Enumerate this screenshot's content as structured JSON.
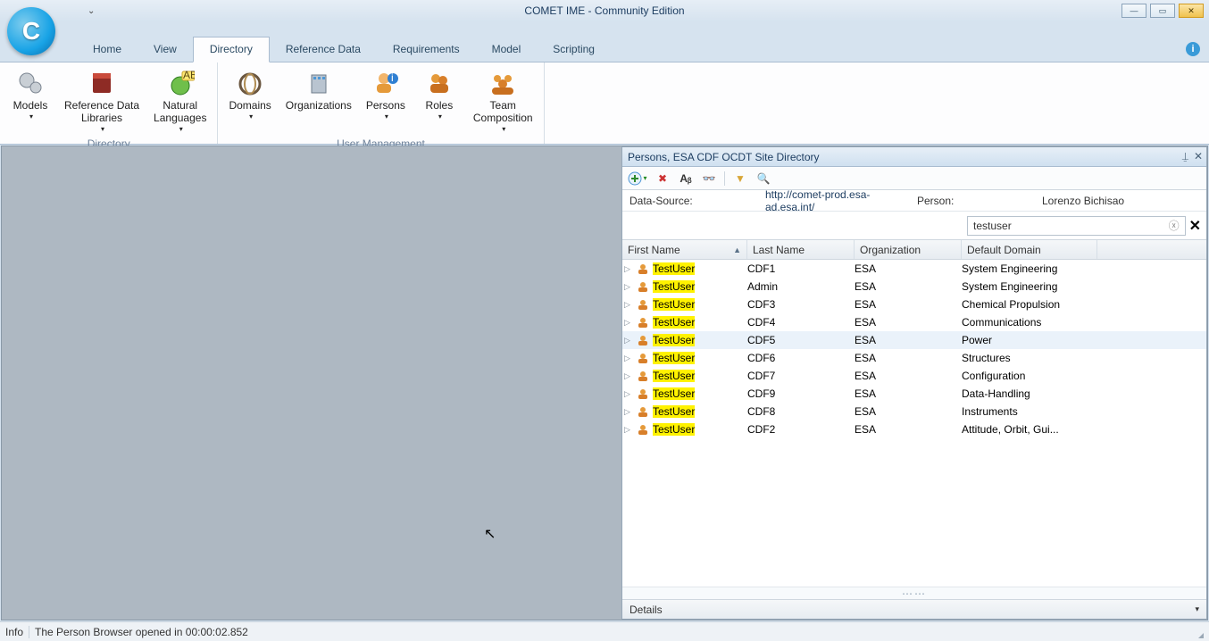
{
  "title": "COMET IME - Community Edition",
  "tabs": [
    "Home",
    "View",
    "Directory",
    "Reference Data",
    "Requirements",
    "Model",
    "Scripting"
  ],
  "active_tab": 2,
  "ribbon": {
    "groups": [
      {
        "label": "Directory",
        "items": [
          {
            "label": "Models",
            "dd": true
          },
          {
            "label": "Reference Data\nLibraries",
            "dd": true
          },
          {
            "label": "Natural\nLanguages",
            "dd": true
          }
        ]
      },
      {
        "label": "User Management",
        "items": [
          {
            "label": "Domains",
            "dd": true
          },
          {
            "label": "Organizations",
            "dd": false
          },
          {
            "label": "Persons",
            "dd": true
          },
          {
            "label": "Roles",
            "dd": true
          },
          {
            "label": "Team\nComposition",
            "dd": true
          }
        ]
      }
    ]
  },
  "panel": {
    "title": "Persons, ESA CDF OCDT Site Directory",
    "datasource_label": "Data-Source:",
    "datasource_value": "http://comet-prod.esa-ad.esa.int/",
    "person_label": "Person:",
    "person_value": "Lorenzo Bichisao",
    "search_value": "testuser",
    "columns": [
      "First Name",
      "Last Name",
      "Organization",
      "Default Domain"
    ],
    "rows": [
      {
        "first": "TestUser",
        "last": "CDF1",
        "org": "ESA",
        "dom": "System Engineering"
      },
      {
        "first": "TestUser",
        "last": "Admin",
        "org": "ESA",
        "dom": "System Engineering"
      },
      {
        "first": "TestUser",
        "last": "CDF3",
        "org": "ESA",
        "dom": "Chemical Propulsion"
      },
      {
        "first": "TestUser",
        "last": "CDF4",
        "org": "ESA",
        "dom": "Communications"
      },
      {
        "first": "TestUser",
        "last": "CDF5",
        "org": "ESA",
        "dom": "Power",
        "sel": true
      },
      {
        "first": "TestUser",
        "last": "CDF6",
        "org": "ESA",
        "dom": "Structures"
      },
      {
        "first": "TestUser",
        "last": "CDF7",
        "org": "ESA",
        "dom": "Configuration"
      },
      {
        "first": "TestUser",
        "last": "CDF9",
        "org": "ESA",
        "dom": "Data-Handling"
      },
      {
        "first": "TestUser",
        "last": "CDF8",
        "org": "ESA",
        "dom": "Instruments"
      },
      {
        "first": "TestUser",
        "last": "CDF2",
        "org": "ESA",
        "dom": "Attitude, Orbit, Gui..."
      }
    ],
    "footer": "Details"
  },
  "status": {
    "label": "Info",
    "text": "The Person Browser opened in 00:00:02.852"
  }
}
